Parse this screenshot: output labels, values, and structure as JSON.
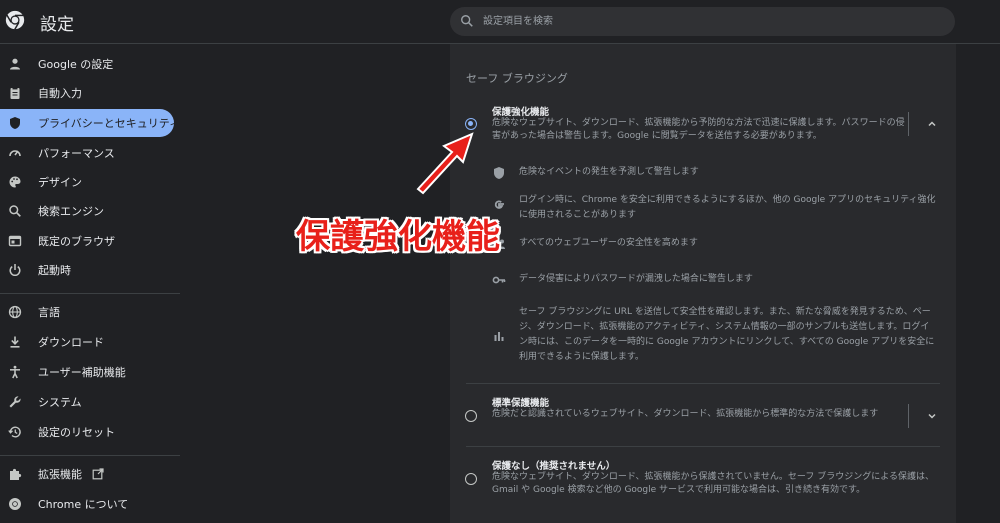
{
  "app": {
    "title": "設定"
  },
  "search": {
    "placeholder": "設定項目を検索"
  },
  "sidebar": {
    "items": [
      {
        "label": "Google の設定",
        "icon": "person-icon"
      },
      {
        "label": "自動入力",
        "icon": "clipboard-icon"
      },
      {
        "label": "プライバシーとセキュリティ",
        "icon": "shield-icon",
        "active": true
      },
      {
        "label": "パフォーマンス",
        "icon": "speedometer-icon"
      },
      {
        "label": "デザイン",
        "icon": "palette-icon"
      },
      {
        "label": "検索エンジン",
        "icon": "search-icon"
      },
      {
        "label": "既定のブラウザ",
        "icon": "browser-icon"
      },
      {
        "label": "起動時",
        "icon": "power-icon"
      },
      {
        "label": "言語",
        "icon": "globe-icon"
      },
      {
        "label": "ダウンロード",
        "icon": "download-icon"
      },
      {
        "label": "ユーザー補助機能",
        "icon": "accessibility-icon"
      },
      {
        "label": "システム",
        "icon": "wrench-icon"
      },
      {
        "label": "設定のリセット",
        "icon": "history-icon"
      },
      {
        "label": "拡張機能",
        "icon": "puzzle-icon"
      },
      {
        "label": "Chrome について",
        "icon": "chrome-icon"
      }
    ]
  },
  "main": {
    "section_title": "セーフ ブラウジング",
    "options": [
      {
        "title": "保護強化機能",
        "desc": "危険なウェブサイト、ダウンロード、拡張機能から予防的な方法で迅速に保護します。パスワードの侵害があった場合は警告します。Google に閲覧データを送信する必要があります。",
        "checked": true,
        "expanded": true
      },
      {
        "title": "標準保護機能",
        "desc": "危険だと認識されているウェブサイト、ダウンロード、拡張機能から標準的な方法で保護します",
        "checked": false
      },
      {
        "title": "保護なし（推奨されません）",
        "desc": "危険なウェブサイト、ダウンロード、拡張機能から保護されていません。セーフ ブラウジングによる保護は、Gmail や Google 検索など他の Google サービスで利用可能な場合は、引き続き有効です。",
        "checked": false
      }
    ],
    "features": [
      {
        "icon": "shield-icon",
        "text": "危険なイベントの発生を予測して警告します"
      },
      {
        "icon": "google-g-icon",
        "text": "ログイン時に、Chrome を安全に利用できるようにするほか、他の Google アプリのセキュリティ強化に使用されることがあります"
      },
      {
        "icon": "people-icon",
        "text": "すべてのウェブユーザーの安全性を高めます"
      },
      {
        "icon": "key-icon",
        "text": "データ侵害によりパスワードが漏洩した場合に警告します"
      },
      {
        "icon": "bar-chart-icon",
        "text": "セーフ ブラウジングに URL を送信して安全性を確認します。また、新たな脅威を発見するため、ページ、ダウンロード、拡張機能のアクティビティ、システム情報の一部のサンプルも送信します。ログイン時には、このデータを一時的に Google アカウントにリンクして、すべての Google アプリを安全に利用できるように保護します。"
      }
    ]
  },
  "annotation": {
    "text": "保護強化機能",
    "color": "#e8201a"
  },
  "colors": {
    "accent": "#8ab4f8",
    "background": "#202124",
    "card": "#292a2d"
  }
}
